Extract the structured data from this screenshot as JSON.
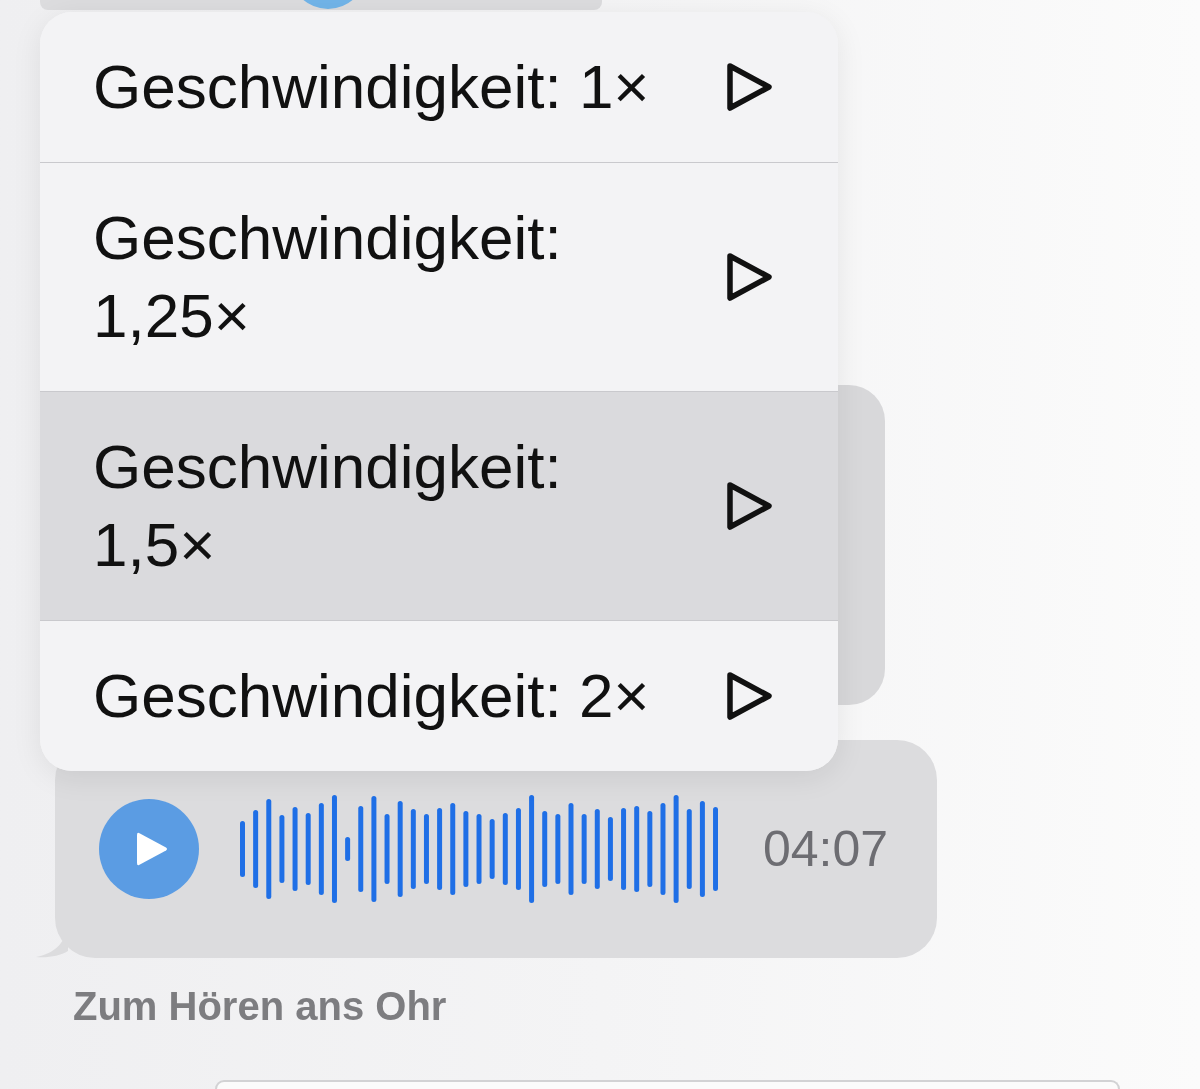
{
  "playback_menu": {
    "items": [
      {
        "label": "Geschwindigkeit: 1×",
        "selected": false
      },
      {
        "label": "Geschwindigkeit: 1,25×",
        "selected": false
      },
      {
        "label": "Geschwindigkeit: 1,5×",
        "selected": true
      },
      {
        "label": "Geschwindigkeit: 2×",
        "selected": false
      }
    ]
  },
  "voice_message": {
    "duration": "04:07"
  },
  "caption": "Zum Hören ans Ohr"
}
